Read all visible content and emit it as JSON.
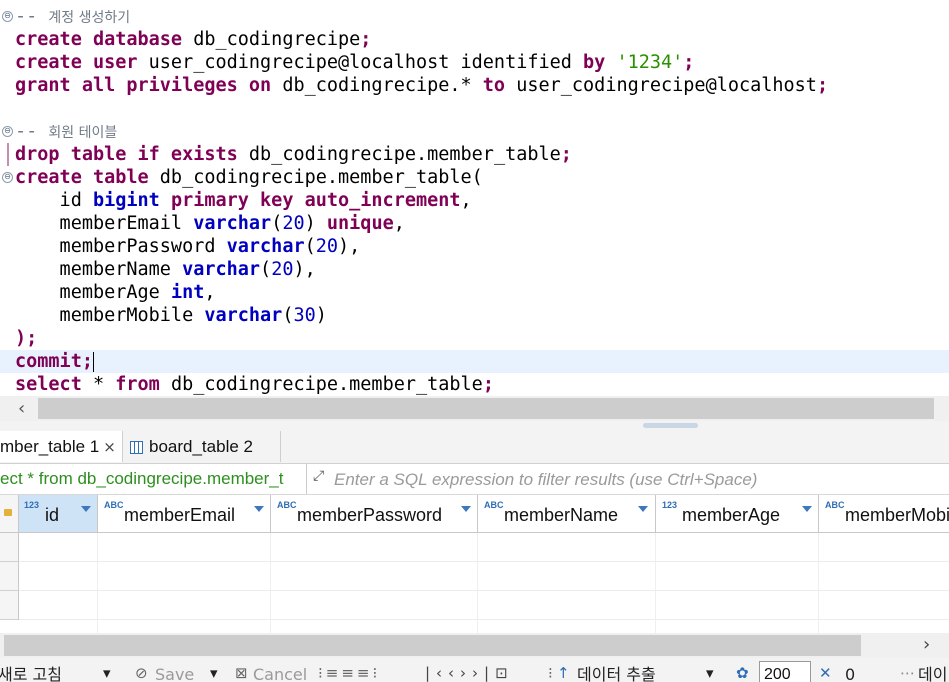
{
  "editor": {
    "lines": [
      {
        "fold": "⊖",
        "parts": [
          {
            "c": "cm",
            "t": "-- "
          },
          {
            "c": "cm ko",
            "t": "계정 생성하기"
          }
        ]
      },
      {
        "parts": [
          {
            "c": "kw",
            "t": "create database "
          },
          {
            "c": "",
            "t": "db_codingrecipe"
          },
          {
            "c": "kw",
            "t": ";"
          }
        ]
      },
      {
        "parts": [
          {
            "c": "kw",
            "t": "create user "
          },
          {
            "c": "",
            "t": "user_codingrecipe@localhost identified "
          },
          {
            "c": "kw",
            "t": "by "
          },
          {
            "c": "str",
            "t": "'1234'"
          },
          {
            "c": "kw",
            "t": ";"
          }
        ]
      },
      {
        "parts": [
          {
            "c": "kw",
            "t": "grant all privileges on "
          },
          {
            "c": "",
            "t": "db_codingrecipe.* "
          },
          {
            "c": "kw",
            "t": "to "
          },
          {
            "c": "",
            "t": "user_codingrecipe@localhost"
          },
          {
            "c": "kw",
            "t": ";"
          }
        ]
      },
      {
        "parts": []
      },
      {
        "fold": "⊖",
        "parts": [
          {
            "c": "cm",
            "t": "-- "
          },
          {
            "c": "cm ko",
            "t": "회원 테이블"
          }
        ]
      },
      {
        "mark": true,
        "parts": [
          {
            "c": "kw",
            "t": "drop table if exists "
          },
          {
            "c": "",
            "t": "db_codingrecipe.member_table"
          },
          {
            "c": "kw",
            "t": ";"
          }
        ]
      },
      {
        "fold": "⊖",
        "parts": [
          {
            "c": "kw",
            "t": "create table "
          },
          {
            "c": "",
            "t": "db_codingrecipe.member_table("
          }
        ]
      },
      {
        "parts": [
          {
            "c": "",
            "t": "    id "
          },
          {
            "c": "ty",
            "t": "bigint "
          },
          {
            "c": "kw",
            "t": "primary key auto_increment"
          },
          {
            "c": "",
            "t": ","
          }
        ]
      },
      {
        "parts": [
          {
            "c": "",
            "t": "    memberEmail "
          },
          {
            "c": "ty",
            "t": "varchar"
          },
          {
            "c": "",
            "t": "("
          },
          {
            "c": "num",
            "t": "20"
          },
          {
            "c": "",
            "t": ") "
          },
          {
            "c": "kw",
            "t": "unique"
          },
          {
            "c": "",
            "t": ","
          }
        ]
      },
      {
        "parts": [
          {
            "c": "",
            "t": "    memberPassword "
          },
          {
            "c": "ty",
            "t": "varchar"
          },
          {
            "c": "",
            "t": "("
          },
          {
            "c": "num",
            "t": "20"
          },
          {
            "c": "",
            "t": "),"
          }
        ]
      },
      {
        "parts": [
          {
            "c": "",
            "t": "    memberName "
          },
          {
            "c": "ty",
            "t": "varchar"
          },
          {
            "c": "",
            "t": "("
          },
          {
            "c": "num",
            "t": "20"
          },
          {
            "c": "",
            "t": "),"
          }
        ]
      },
      {
        "parts": [
          {
            "c": "",
            "t": "    memberAge "
          },
          {
            "c": "ty",
            "t": "int"
          },
          {
            "c": "",
            "t": ","
          }
        ]
      },
      {
        "parts": [
          {
            "c": "",
            "t": "    memberMobile "
          },
          {
            "c": "ty",
            "t": "varchar"
          },
          {
            "c": "",
            "t": "("
          },
          {
            "c": "num",
            "t": "30"
          },
          {
            "c": "",
            "t": ")"
          }
        ]
      },
      {
        "parts": [
          {
            "c": "kw",
            "t": ")"
          },
          {
            "c": "kw",
            "t": ";"
          }
        ]
      },
      {
        "current": true,
        "caret": true,
        "parts": [
          {
            "c": "kw",
            "t": "commit"
          },
          {
            "c": "kw",
            "t": ";"
          }
        ]
      },
      {
        "parts": [
          {
            "c": "kw",
            "t": "select "
          },
          {
            "c": "",
            "t": "* "
          },
          {
            "c": "kw",
            "t": "from "
          },
          {
            "c": "",
            "t": "db_codingrecipe.member_table"
          },
          {
            "c": "kw",
            "t": ";"
          }
        ]
      }
    ]
  },
  "result_tabs": {
    "tab1_label": "mber_table 1",
    "tab2_label": "board_table 2"
  },
  "filter": {
    "query_text": "ect * from db_codingrecipe.member_t",
    "placeholder": "Enter a SQL expression to filter results (use Ctrl+Space)"
  },
  "grid": {
    "columns": [
      {
        "label": "id",
        "type_badge": "123"
      },
      {
        "label": "memberEmail",
        "type_badge": "ABC"
      },
      {
        "label": "memberPassword",
        "type_badge": "ABC"
      },
      {
        "label": "memberName",
        "type_badge": "ABC"
      },
      {
        "label": "memberAge",
        "type_badge": "123"
      },
      {
        "label": "memberMobile",
        "type_badge": "ABC"
      }
    ]
  },
  "toolbar": {
    "refresh_label": "새로 고침",
    "save_label": "Save",
    "cancel_label": "Cancel",
    "export_label": "데이터 추출",
    "fetch_size": "200",
    "row_count": "0",
    "more_label": "데이"
  }
}
